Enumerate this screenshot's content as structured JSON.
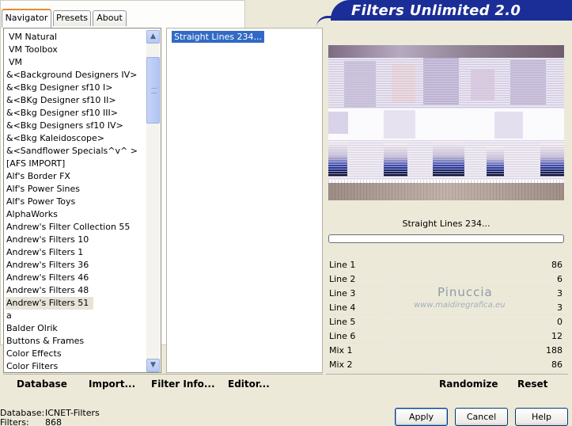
{
  "tabs": [
    {
      "label": "Navigator",
      "active": true
    },
    {
      "label": "Presets",
      "active": false
    },
    {
      "label": "About",
      "active": false
    }
  ],
  "header": {
    "title": "Filters Unlimited 2.0"
  },
  "nav_list": {
    "items": [
      "VM Natural",
      "VM Toolbox",
      "VM",
      "&<Background Designers IV>",
      "&<Bkg Designer sf10 I>",
      "&<BKg Designer sf10 II>",
      "&<Bkg Designer sf10 III>",
      "&<Bkg Designers sf10 IV>",
      "&<Bkg Kaleidoscope>",
      "&<Sandflower Specials^v^ >",
      "[AFS IMPORT]",
      "Alf's Border FX",
      "Alf's Power Sines",
      "Alf's Power Toys",
      "AlphaWorks",
      "Andrew's Filter Collection 55",
      "Andrew's Filters 10",
      "Andrew's Filters 1",
      "Andrew's Filters 36",
      "Andrew's Filters 46",
      "Andrew's Filters 48",
      "Andrew's Filters 51",
      "a",
      "Balder Olrik",
      "Buttons & Frames",
      "Color Effects",
      "Color Filters"
    ],
    "selected": "Andrew's Filters 51"
  },
  "filter_list": {
    "items": [
      "Straight Lines 234..."
    ],
    "selected": "Straight Lines 234..."
  },
  "preview": {
    "label": "Straight Lines 234..."
  },
  "parameters": [
    {
      "name": "Line 1",
      "value": 86
    },
    {
      "name": "Line 2",
      "value": 6
    },
    {
      "name": "Line 3",
      "value": 3
    },
    {
      "name": "Line 4",
      "value": 3
    },
    {
      "name": "Line 5",
      "value": 0
    },
    {
      "name": "Line 6",
      "value": 12
    },
    {
      "name": "Mix 1",
      "value": 188
    },
    {
      "name": "Mix 2",
      "value": 86
    }
  ],
  "watermark": {
    "title": "Pinuccia",
    "url": "www.maidiregrafica.eu"
  },
  "left_actions": {
    "database": "Database",
    "import": "Import...",
    "filter_info": "Filter Info...",
    "editor": "Editor..."
  },
  "right_actions": {
    "randomize": "Randomize",
    "reset": "Reset"
  },
  "info": {
    "database_label": "Database:",
    "database_value": "ICNET-Filters",
    "filters_label": "Filters:",
    "filters_value": "868"
  },
  "dialog_buttons": {
    "apply": "Apply",
    "cancel": "Cancel",
    "help": "Help"
  },
  "icons": {
    "scroll_up": "chevron-up-icon",
    "scroll_down": "chevron-down-icon"
  },
  "colors": {
    "banner": "#1b2d96",
    "selection": "#316ac5",
    "tab_highlight": "#e68b2c"
  }
}
